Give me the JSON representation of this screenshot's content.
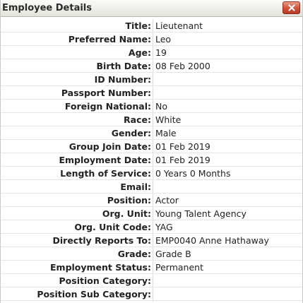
{
  "window": {
    "title": "Employee Details"
  },
  "icons": {
    "close": "close-x-icon"
  },
  "colors": {
    "close_button": "#c9452d",
    "titlebar": "#eeeeea"
  },
  "fields": [
    {
      "label": "Title",
      "value": "Lieutenant"
    },
    {
      "label": "Preferred Name",
      "value": "Leo"
    },
    {
      "label": "Age",
      "value": "19"
    },
    {
      "label": "Birth Date",
      "value": "08 Feb 2000"
    },
    {
      "label": "ID Number",
      "value": ""
    },
    {
      "label": "Passport Number",
      "value": ""
    },
    {
      "label": "Foreign National",
      "value": "No"
    },
    {
      "label": "Race",
      "value": "White"
    },
    {
      "label": "Gender",
      "value": "Male"
    },
    {
      "label": "Group Join Date",
      "value": "01 Feb 2019"
    },
    {
      "label": "Employment Date",
      "value": "01 Feb 2019"
    },
    {
      "label": "Length of Service",
      "value": "0 Years 0 Months"
    },
    {
      "label": "Email",
      "value": ""
    },
    {
      "label": "Position",
      "value": "Actor"
    },
    {
      "label": "Org. Unit",
      "value": "Young Talent Agency"
    },
    {
      "label": "Org. Unit Code",
      "value": "YAG"
    },
    {
      "label": "Directly Reports To",
      "value": "EMP0040 Anne Hathaway"
    },
    {
      "label": "Grade",
      "value": "Grade B"
    },
    {
      "label": "Employment Status",
      "value": "Permanent"
    },
    {
      "label": "Position Category",
      "value": ""
    },
    {
      "label": "Position Sub Category",
      "value": ""
    }
  ]
}
